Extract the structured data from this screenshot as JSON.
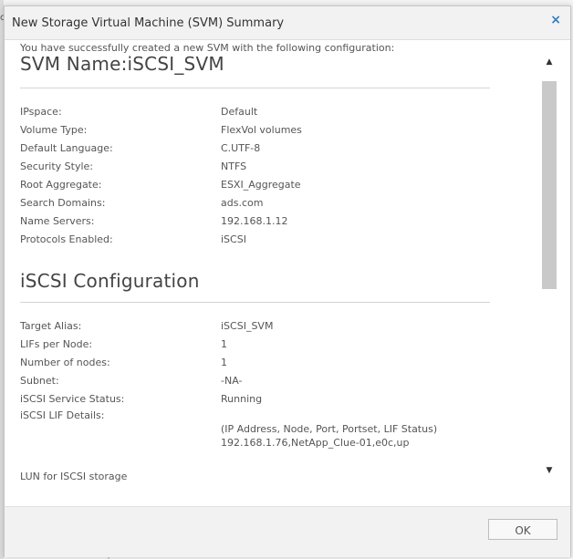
{
  "dialog": {
    "title": "New Storage Virtual Machine (SVM) Summary",
    "close_glyph": "×",
    "success_message": "You have successfully created a new SVM with the following configuration:"
  },
  "svm": {
    "heading": "SVM Name:iSCSI_SVM",
    "rows": [
      {
        "label": "IPspace:",
        "value": "Default"
      },
      {
        "label": "Volume Type:",
        "value": "FlexVol volumes"
      },
      {
        "label": "Default Language:",
        "value": "C.UTF-8"
      },
      {
        "label": "Security Style:",
        "value": "NTFS"
      },
      {
        "label": "Root Aggregate:",
        "value": "ESXI_Aggregate"
      },
      {
        "label": "Search Domains:",
        "value": "ads.com"
      },
      {
        "label": "Name Servers:",
        "value": "192.168.1.12"
      },
      {
        "label": "Protocols Enabled:",
        "value": "iSCSI"
      }
    ]
  },
  "iscsi": {
    "heading": "iSCSI Configuration",
    "rows": [
      {
        "label": "Target Alias:",
        "value": "iSCSI_SVM"
      },
      {
        "label": "LIFs per Node:",
        "value": "1"
      },
      {
        "label": "Number of nodes:",
        "value": "1"
      },
      {
        "label": "Subnet:",
        "value": "-NA-"
      },
      {
        "label": "iSCSI Service Status:",
        "value": "Running"
      }
    ],
    "lif_details_label": "iSCSI LIF Details:",
    "lif_details_header": "(IP Address, Node, Port, Portset, LIF Status)",
    "lif_details_value": "192.168.1.76,NetApp_Clue-01,e0c,up",
    "lun_label": "LUN for ISCSI storage"
  },
  "scrollbar": {
    "up_glyph": "▲",
    "down_glyph": "▼"
  },
  "footer": {
    "ok_label": "OK"
  },
  "background": {
    "edge_glyph": "c"
  }
}
